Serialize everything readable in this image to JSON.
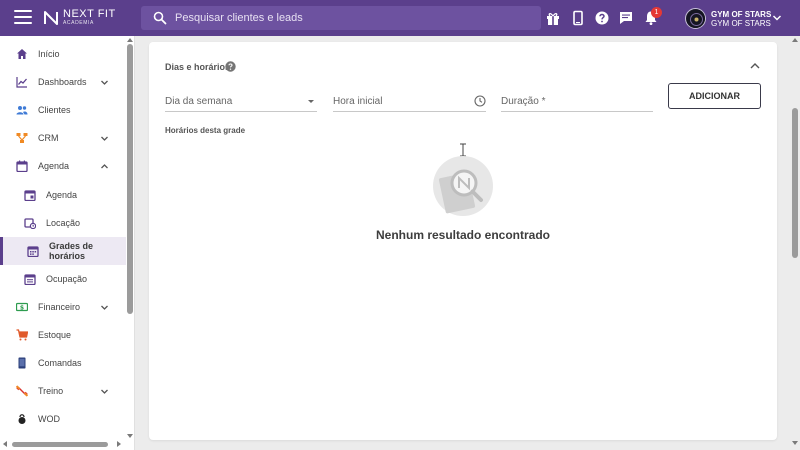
{
  "brand": {
    "name": "NEXT FIT",
    "tagline": "ACADEMIA",
    "primary_color": "#5b3f8c"
  },
  "search": {
    "placeholder": "Pesquisar clientes e leads"
  },
  "header": {
    "icons": [
      "gift-icon",
      "mobile-icon",
      "help-icon",
      "chat-icon",
      "bell-icon"
    ],
    "notification_count": "1",
    "user": {
      "name": "GYM OF STARS",
      "org": "GYM OF STARS"
    }
  },
  "sidebar": {
    "items": [
      {
        "label": "Início",
        "icon": "home-icon",
        "color": "#5b3f8c"
      },
      {
        "label": "Dashboards",
        "icon": "chart-line-icon",
        "color": "#5b3f8c",
        "expandable": true
      },
      {
        "label": "Clientes",
        "icon": "people-icon",
        "color": "#3f7bd6"
      },
      {
        "label": "CRM",
        "icon": "hierarchy-icon",
        "color": "#f08a24",
        "expandable": true
      },
      {
        "label": "Agenda",
        "icon": "calendar-icon",
        "color": "#5b3f8c",
        "expanded": true
      },
      {
        "label": "Agenda",
        "icon": "calendar-sub-icon",
        "sub": true,
        "color": "#5b3f8c"
      },
      {
        "label": "Locação",
        "icon": "calendar-clock-icon",
        "sub": true,
        "color": "#5b3f8c"
      },
      {
        "label": "Grades de horários",
        "icon": "calendar-grid-icon",
        "sub": true,
        "active": true,
        "color": "#5b3f8c"
      },
      {
        "label": "Ocupação",
        "icon": "calendar-list-icon",
        "sub": true,
        "color": "#5b3f8c"
      },
      {
        "label": "Financeiro",
        "icon": "money-icon",
        "color": "#2e9c4f",
        "expandable": true
      },
      {
        "label": "Estoque",
        "icon": "cart-icon",
        "color": "#e05a2b"
      },
      {
        "label": "Comandas",
        "icon": "tablet-icon",
        "color": "#2b3f7a"
      },
      {
        "label": "Treino",
        "icon": "dumbbell-icon",
        "color": "#d9322e",
        "expandable": true
      },
      {
        "label": "WOD",
        "icon": "kettlebell-icon",
        "color": "#222222"
      }
    ]
  },
  "main": {
    "section_title": "Dias e horários",
    "fields": {
      "weekday_placeholder": "Dia da semana",
      "start_placeholder": "Hora inicial",
      "duration_placeholder": "Duração *"
    },
    "add_button": "ADICIONAR",
    "list_title": "Horários desta grade",
    "empty_message": "Nenhum resultado encontrado"
  }
}
